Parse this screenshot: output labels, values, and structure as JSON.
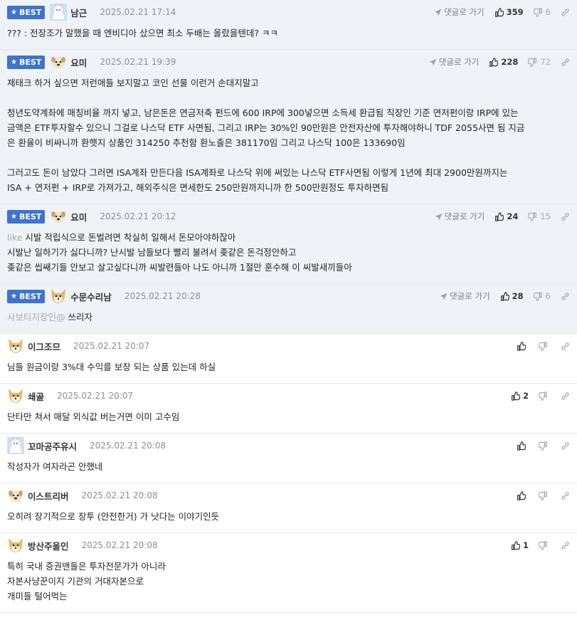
{
  "best_label": "BEST",
  "reply_label": "댓글로 가기",
  "comments": [
    {
      "best": true,
      "avatar": "cat-avatar",
      "nick": "남근",
      "date": "2025.02.21 17:14",
      "likes": "359",
      "dislikes": "6",
      "lines": [
        "??? : 전장조가 말했을 때 엔비디아 샀으면 최소 두배는 올랐을텐데? ㅋㅋ"
      ]
    },
    {
      "best": true,
      "avatar": "dog-avatar",
      "nick": "요미",
      "date": "2025.02.21 19:39",
      "likes": "228",
      "dislikes": "72",
      "lines": [
        "제태크 하거 싶으면 저런애들 보지말고 코인 선물 이런거 손대지말고",
        "",
        "청년도약계좌에 매칭비율 까지 넣고, 남은돈은 연금저축 펀드에 600 IRP에 300넣으면 소득세 환급됨 직장인 기준 연저펀이랑 IRP에 있는",
        "금액은 ETF투자할수 있으니 그걸로 나스닥 ETF 사면됨, 그리고 IRP는 30%인 90만원은 안전자산에 투자해야하니 TDF 2055사면 됨 지금",
        "은 환율이 비싸니까 환햇지 상품인 314250 추천함 환노출은 381170임 그리고 나스닥 100은 133690임",
        "",
        "그러고도 돈이 남았다 그러면 ISA계좌 만든다음 ISA계좌로 나스닥 위에 써있는 나스닥 ETF사면됨 이렇게 1년에 최대 2900만원까지는",
        "ISA + 연저펀 + IRP로 가져가고, 해외주식은 면세한도 250만원까지니까 한 500만원정도 투자하면됨"
      ]
    },
    {
      "best": true,
      "avatar": "dog-avatar",
      "nick": "요미",
      "date": "2025.02.21 20:12",
      "likes": "24",
      "dislikes": "15",
      "ref": "like",
      "lines": [
        "시발 적립식으로 돈벌려면 착실히 일해서 돈모아야하잖아",
        "시발난 일하기가 싫다니까? 난시발 남들보다 빨리 불려서 좆같은 돈걱정안하고",
        "좆같은 씹쌔기들 안보고 살고싶다니까 씨발련들아 나도 아니까 1절만 훈수해 이 씨발새끼들아"
      ]
    },
    {
      "best": true,
      "avatar": "fox-avatar",
      "nick": "수문수리남",
      "date": "2025.02.21 20:28",
      "likes": "28",
      "dislikes": "6",
      "ref": "사보티지장인@",
      "lines": [
        "쓰리자"
      ]
    },
    {
      "best": false,
      "avatar": "fox-avatar",
      "nick": "이그조므",
      "date": "2025.02.21 20:07",
      "likes": "",
      "dislikes": "",
      "lines": [
        "님들 원금이랑 3%대 수익를 보장 되는 상품 있는데 하실"
      ]
    },
    {
      "best": false,
      "avatar": "fox-avatar",
      "nick": "쇄골",
      "date": "2025.02.21 20:07",
      "likes": "2",
      "dislikes": "",
      "lines": [
        "단타만 쳐서 매달 외식값 버는거면 이미 고수임"
      ]
    },
    {
      "best": false,
      "avatar": "cat-avatar",
      "nick": "꼬마공주유시",
      "date": "2025.02.21 20:08",
      "likes": "",
      "dislikes": "",
      "lines": [
        "작성자가 여자라곤 안했네"
      ]
    },
    {
      "best": false,
      "avatar": "dog-avatar",
      "nick": "이스트리버",
      "date": "2025.02.21 20:08",
      "likes": "",
      "dislikes": "",
      "lines": [
        "오히려 장기적으로 장투 (안전한거) 가 낫다는 이야기인듯"
      ]
    },
    {
      "best": false,
      "avatar": "fox-avatar",
      "nick": "방산주올인",
      "date": "2025.02.21 20:08",
      "likes": "1",
      "dislikes": "",
      "lines": [
        "특히 국내 증권맨들은 투자전문가가 아니라",
        "자본사냥꾼이지 기관의 거대자본으로",
        "개미들 털어먹는"
      ]
    }
  ],
  "colors": {
    "best_bg": "#eff3f8",
    "badge": "#3d73d1",
    "border": "#e3e6ea"
  }
}
